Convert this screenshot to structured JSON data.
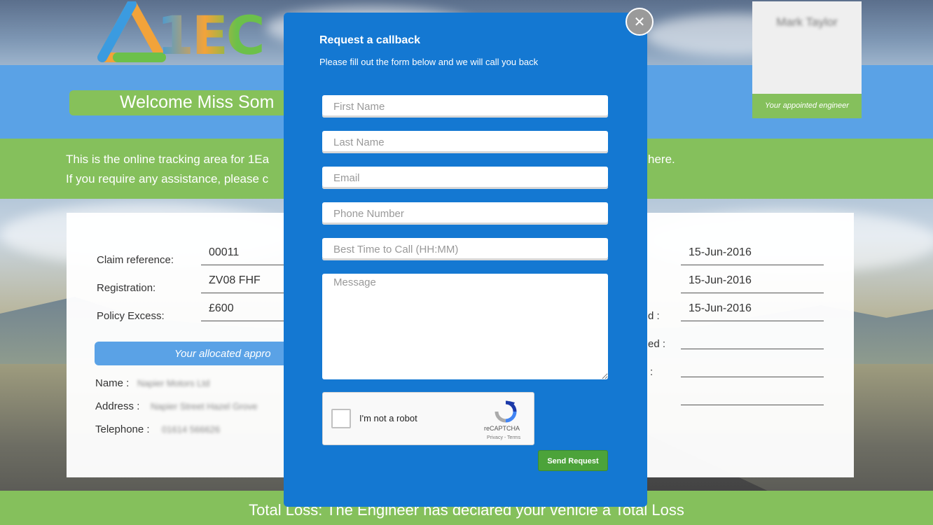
{
  "header": {
    "logo_text": "1EC",
    "welcome": "Welcome Miss Som"
  },
  "engineer": {
    "name": "Mark Taylor",
    "caption": "Your appointed engineer"
  },
  "intro": {
    "line1_left": "This is the online tracking area for 1Ea",
    "line1_right": "here.",
    "line2_left": "If you require any assistance, please c"
  },
  "claim": {
    "reference_label": "Claim reference:",
    "reference_value": "00011",
    "registration_label": "Registration:",
    "registration_value": "ZV08 FHF",
    "excess_label": "Policy Excess:",
    "excess_value": "£600",
    "approver_bar": "Your allocated appro",
    "name_label": "Name :",
    "name_value": "Napier Motors Ltd",
    "address_label": "Address :",
    "address_value": "Napier Street Hazel Grove",
    "telephone_label": "Telephone :",
    "telephone_value": "01614 566626"
  },
  "dates": {
    "row1_value": "15-Jun-2016",
    "row2_value": "15-Jun-2016",
    "row3_label": "d :",
    "row3_value": "15-Jun-2016",
    "row4_label": "ed :",
    "row5_label": ":",
    "row6_label": ":"
  },
  "status": {
    "total_loss": "Total Loss: The Engineer has declared your vehicle a Total Loss"
  },
  "modal": {
    "title": "Request a callback",
    "subtitle": "Please fill out the form below and we will call you back",
    "first_name_placeholder": "First Name",
    "last_name_placeholder": "Last Name",
    "email_placeholder": "Email",
    "phone_placeholder": "Phone Number",
    "time_placeholder": "Best Time to Call (HH:MM)",
    "message_placeholder": "Message",
    "captcha_label": "I'm not a robot",
    "captcha_brand": "reCAPTCHA",
    "captcha_terms": "Privacy - Terms",
    "send_label": "Send Request",
    "close_glyph": "✕"
  },
  "icons": {
    "close": "close-icon",
    "recaptcha": "recaptcha-icon",
    "logo": "logo-triangle-icon"
  },
  "colors": {
    "modal_blue": "#1478d2",
    "band_green": "#85c05c",
    "band_blue": "#5aa2e6",
    "send_green": "#4ca33a"
  }
}
